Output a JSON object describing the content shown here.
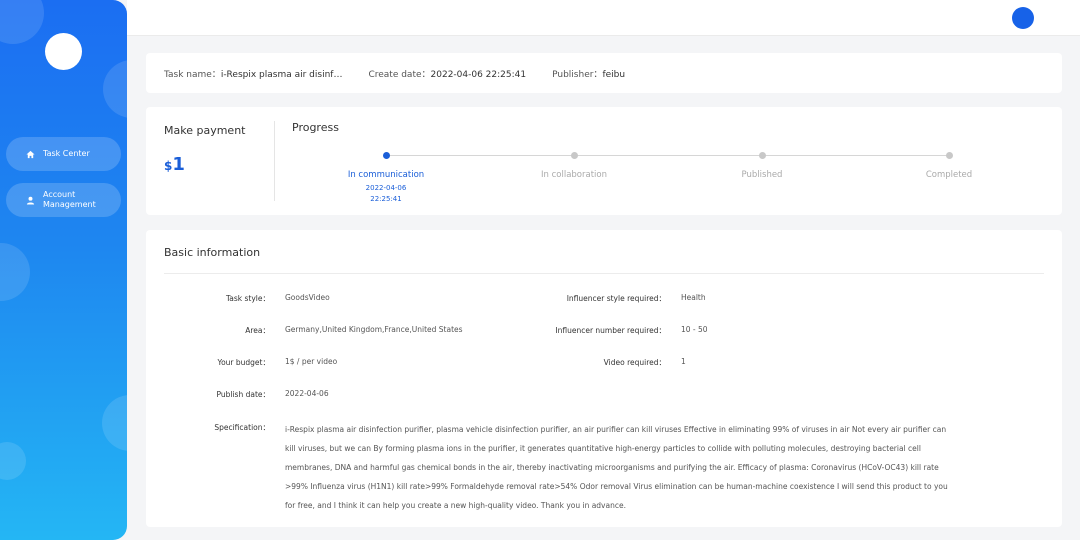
{
  "sidebar": {
    "items": [
      {
        "label": "Task Center",
        "icon": "home-icon"
      },
      {
        "label": "Account Management",
        "icon": "user-icon"
      }
    ]
  },
  "task": {
    "name_label": "Task name：",
    "name_value": "i-Respix plasma air disinf…",
    "date_label": "Create date：",
    "date_value": "2022-04-06 22:25:41",
    "publisher_label": "Publisher：",
    "publisher_value": "feibu"
  },
  "payment": {
    "title": "Make payment",
    "currency": "$",
    "amount": "1"
  },
  "progress": {
    "title": "Progress",
    "current_step": 0,
    "steps": [
      {
        "label": "In communication",
        "date": "2022-04-06",
        "time": "22:25:41"
      },
      {
        "label": "In collaboration"
      },
      {
        "label": "Published"
      },
      {
        "label": "Completed"
      }
    ]
  },
  "basic": {
    "title": "Basic information",
    "task_style_label": "Task style：",
    "task_style_value": "GoodsVideo",
    "area_label": "Area：",
    "area_value": "Germany,United Kingdom,France,United States",
    "budget_label": "Your budget：",
    "budget_value": "1$ / per video",
    "publish_label": "Publish date：",
    "publish_value": "2022-04-06",
    "inf_style_label": "Influencer style required：",
    "inf_style_value": "Health",
    "inf_number_label": "Influencer number required：",
    "inf_number_value": "10 - 50",
    "video_label": "Video required：",
    "video_value": "1",
    "spec_label": "Specification：",
    "spec_value": "i-Respix plasma air disinfection purifier, plasma vehicle disinfection purifier, an air purifier can kill viruses Effective in eliminating 99% of viruses in air Not every air purifier can kill viruses, but we can By forming plasma ions in the purifier, it generates quantitative high-energy particles to collide with polluting molecules, destroying bacterial cell membranes, DNA and harmful gas chemical bonds in the air, thereby inactivating microorganisms and purifying the air. Efficacy of plasma: Coronavirus (HCoV-OC43) kill rate >99% Influenza virus (H1N1) kill rate>99% Formaldehyde removal rate>54% Odor removal Virus elimination can be human-machine coexistence I will send this product to you for free, and I think it can help you create a new high-quality video. Thank you in advance."
  },
  "colors": {
    "accent": "#1a5ed8",
    "sidebar_top": "#1b6ef2",
    "sidebar_bottom": "#24b6f4",
    "inactive_step": "#c8c8c8"
  }
}
